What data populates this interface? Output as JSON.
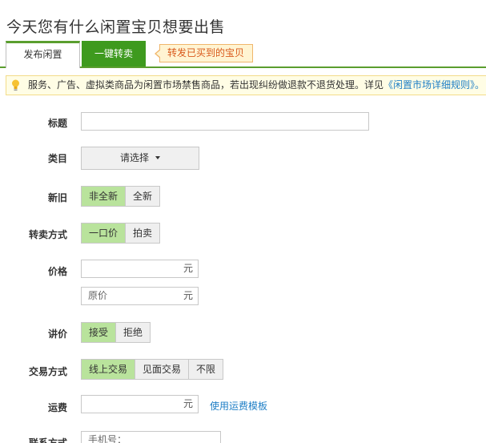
{
  "header": {
    "title": "今天您有什么闲置宝贝想要出售"
  },
  "tabs": {
    "publish": "发布闲置",
    "resell": "一键转卖",
    "tip": "转发已买到的宝贝"
  },
  "notice": {
    "text": "服务、广告、虚拟类商品为闲置市场禁售商品，若出现纠纷做退款不退货处理。详见",
    "link": "《闲置市场详细规则》。"
  },
  "form": {
    "title_label": "标题",
    "title_value": "",
    "category_label": "类目",
    "category_select": "请选择",
    "condition_label": "新旧",
    "condition_options": [
      "非全新",
      "全新"
    ],
    "condition_selected": "非全新",
    "sale_label": "转卖方式",
    "sale_options": [
      "一口价",
      "拍卖"
    ],
    "sale_selected": "一口价",
    "price_label": "价格",
    "price_unit": "元",
    "original_price_placeholder": "原价",
    "original_price_unit": "元",
    "bargain_label": "讲价",
    "bargain_options": [
      "接受",
      "拒绝"
    ],
    "bargain_selected": "接受",
    "trade_label": "交易方式",
    "trade_options": [
      "线上交易",
      "见面交易",
      "不限"
    ],
    "trade_selected": "线上交易",
    "shipping_label": "运费",
    "shipping_unit": "元",
    "shipping_template_link": "使用运费模板",
    "contact_label": "联系方式",
    "phone_placeholder": "手机号："
  },
  "colors": {
    "accent_green": "#3e9a1e",
    "selected_bg": "#b9e39c",
    "link_blue": "#1f7fc6",
    "tip_orange": "#d9581a"
  }
}
